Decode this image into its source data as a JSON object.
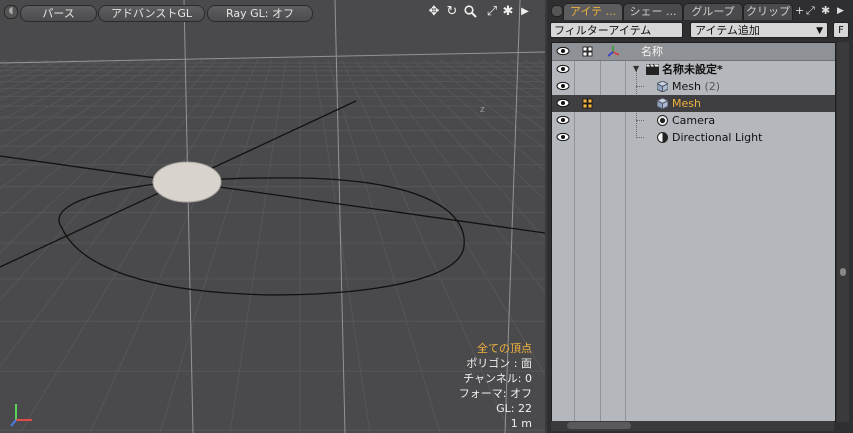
{
  "viewport": {
    "buttons": [
      "パース",
      "アドバンストGL",
      "Ray GL: オフ"
    ],
    "icons": [
      "move-view-icon",
      "rotate-view-icon",
      "zoom-view-icon",
      "maximize-view-icon",
      "gear-icon",
      "expand-arrow-icon"
    ],
    "axis_label": "z",
    "info": {
      "mode": "全ての頂点",
      "polygon": "ポリゴン : 面",
      "channel": "チャンネル: 0",
      "deformer": "フォーマ: オフ",
      "gl": "GL: 22",
      "scale": "1 m"
    },
    "colors": {
      "highlight": "#f0b23c",
      "background": "#4a4a4c",
      "disc": "#d8d3cc"
    }
  },
  "panel": {
    "tabs": [
      {
        "label": "アイテ ...",
        "active": true
      },
      {
        "label": "シェー ...",
        "active": false
      },
      {
        "label": "グループ",
        "active": false
      },
      {
        "label": "クリップ",
        "active": false
      }
    ],
    "tab_icons": [
      "add-tab-icon",
      "maximize-panel-icon",
      "gear-icon",
      "more-arrow-icon"
    ],
    "filter": {
      "value": "フィルターアイテム"
    },
    "add_item": {
      "label": "アイテム追加"
    },
    "f_button": "F",
    "columns": {
      "name": "名称"
    },
    "items": [
      {
        "name": "名称未設定*",
        "count": "",
        "type": "scene",
        "selected": false
      },
      {
        "name": "Mesh",
        "count": "(2)",
        "type": "mesh",
        "selected": false
      },
      {
        "name": "Mesh",
        "count": "",
        "type": "mesh",
        "selected": true
      },
      {
        "name": "Camera",
        "count": "",
        "type": "camera",
        "selected": false
      },
      {
        "name": "Directional Light",
        "count": "",
        "type": "light",
        "selected": false
      }
    ]
  }
}
